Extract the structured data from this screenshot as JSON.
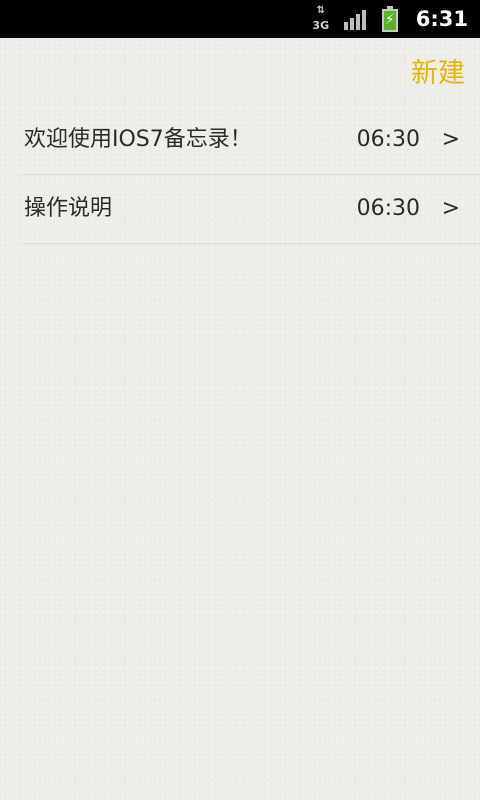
{
  "status_bar": {
    "network_type": "3G",
    "network_arrows": "⇅",
    "signal_bars": 4,
    "battery_state": "charging",
    "battery_bolt": "⚡",
    "time": "6:31"
  },
  "header": {
    "new_label": "新建",
    "accent_color": "#e2b40e"
  },
  "notes": [
    {
      "title": "欢迎使用IOS7备忘录！",
      "time": "06:30",
      "chevron": ">"
    },
    {
      "title": "操作说明",
      "time": "06:30",
      "chevron": ">"
    }
  ]
}
